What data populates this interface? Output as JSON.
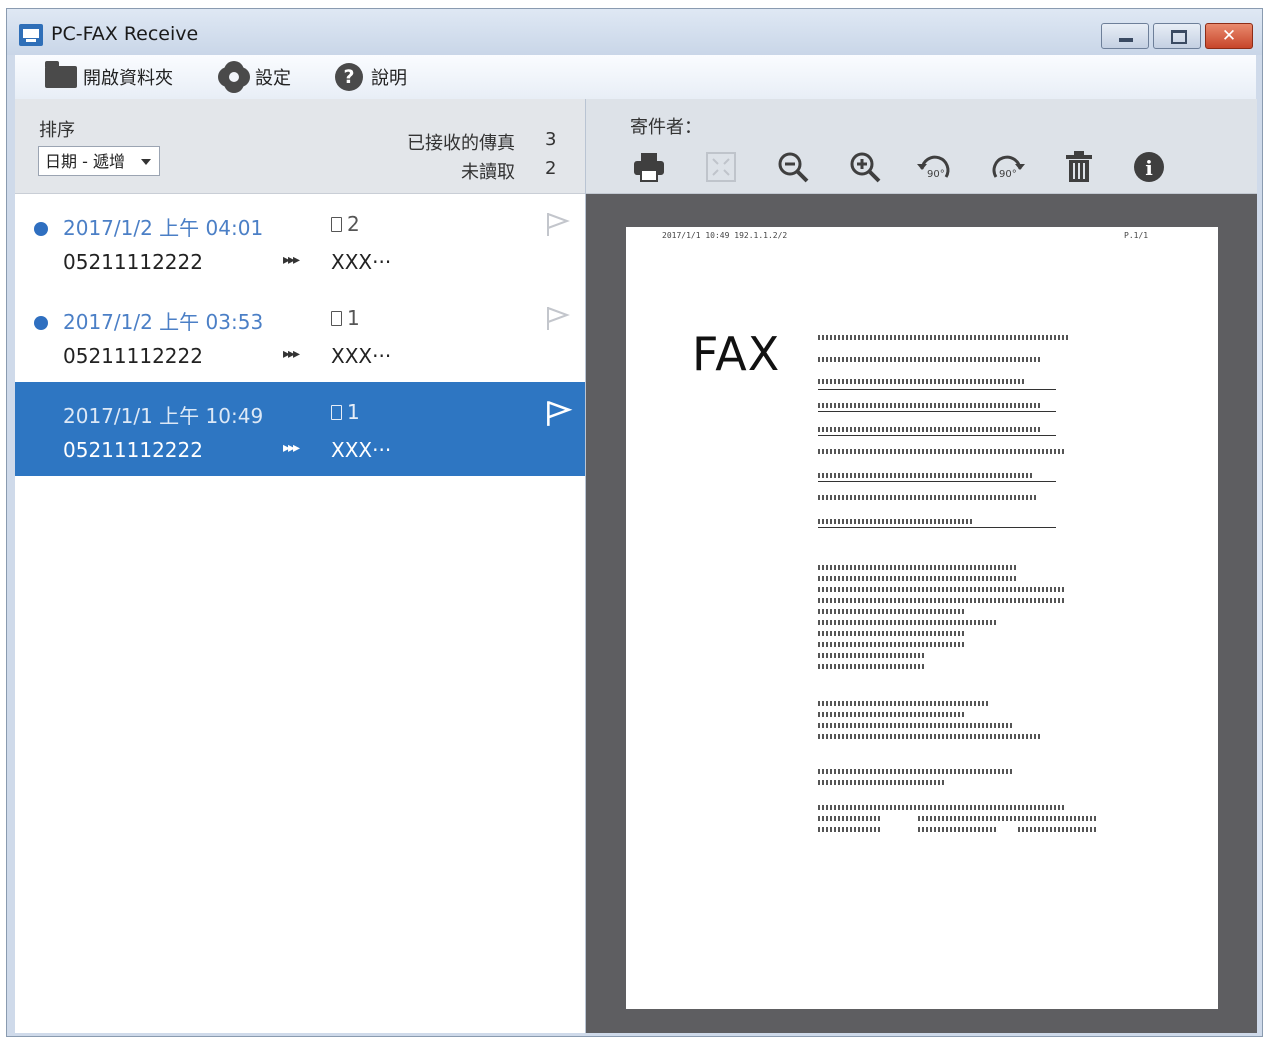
{
  "window": {
    "title": "PC-FAX Receive",
    "close_glyph": "✕"
  },
  "menu": [
    {
      "label": "開啟資料夾",
      "icon": "folder-icon"
    },
    {
      "label": "設定",
      "icon": "gear-icon"
    },
    {
      "label": "說明",
      "icon": "help-icon",
      "glyph": "?"
    }
  ],
  "list_header": {
    "sort_label": "排序",
    "sort_value": "日期 - 遞增",
    "received_label": "已接收的傳真",
    "received_count": "3",
    "unread_label": "未讀取",
    "unread_count": "2"
  },
  "faxes": [
    {
      "date": "2017/1/2 上午 04:01",
      "pages": "2",
      "number": "05211112222",
      "arrows": "▸▸▸",
      "sender": "XXX···",
      "unread": true,
      "selected": false
    },
    {
      "date": "2017/1/2 上午 03:53",
      "pages": "1",
      "number": "05211112222",
      "arrows": "▸▸▸",
      "sender": "XXX···",
      "unread": true,
      "selected": false
    },
    {
      "date": "2017/1/1 上午 10:49",
      "pages": "1",
      "number": "05211112222",
      "arrows": "▸▸▸",
      "sender": "XXX···",
      "unread": false,
      "selected": true
    }
  ],
  "viewer": {
    "sender_label": "寄件者：",
    "tools": [
      "print-icon",
      "fit-page-icon",
      "zoom-out-icon",
      "zoom-in-icon",
      "rotate-left-90-icon",
      "rotate-right-90-icon",
      "trash-icon",
      "info-icon"
    ],
    "rotate_label": "90°",
    "info_glyph": "i"
  },
  "preview": {
    "header_left": "2017/1/1  10:49   192.1.1.2/2",
    "header_right": "P.1/1",
    "title": "FAX"
  },
  "colors": {
    "selected_row": "#2e76c2",
    "unread_dot": "#2f6fc0",
    "date_text": "#4b7fc6"
  }
}
